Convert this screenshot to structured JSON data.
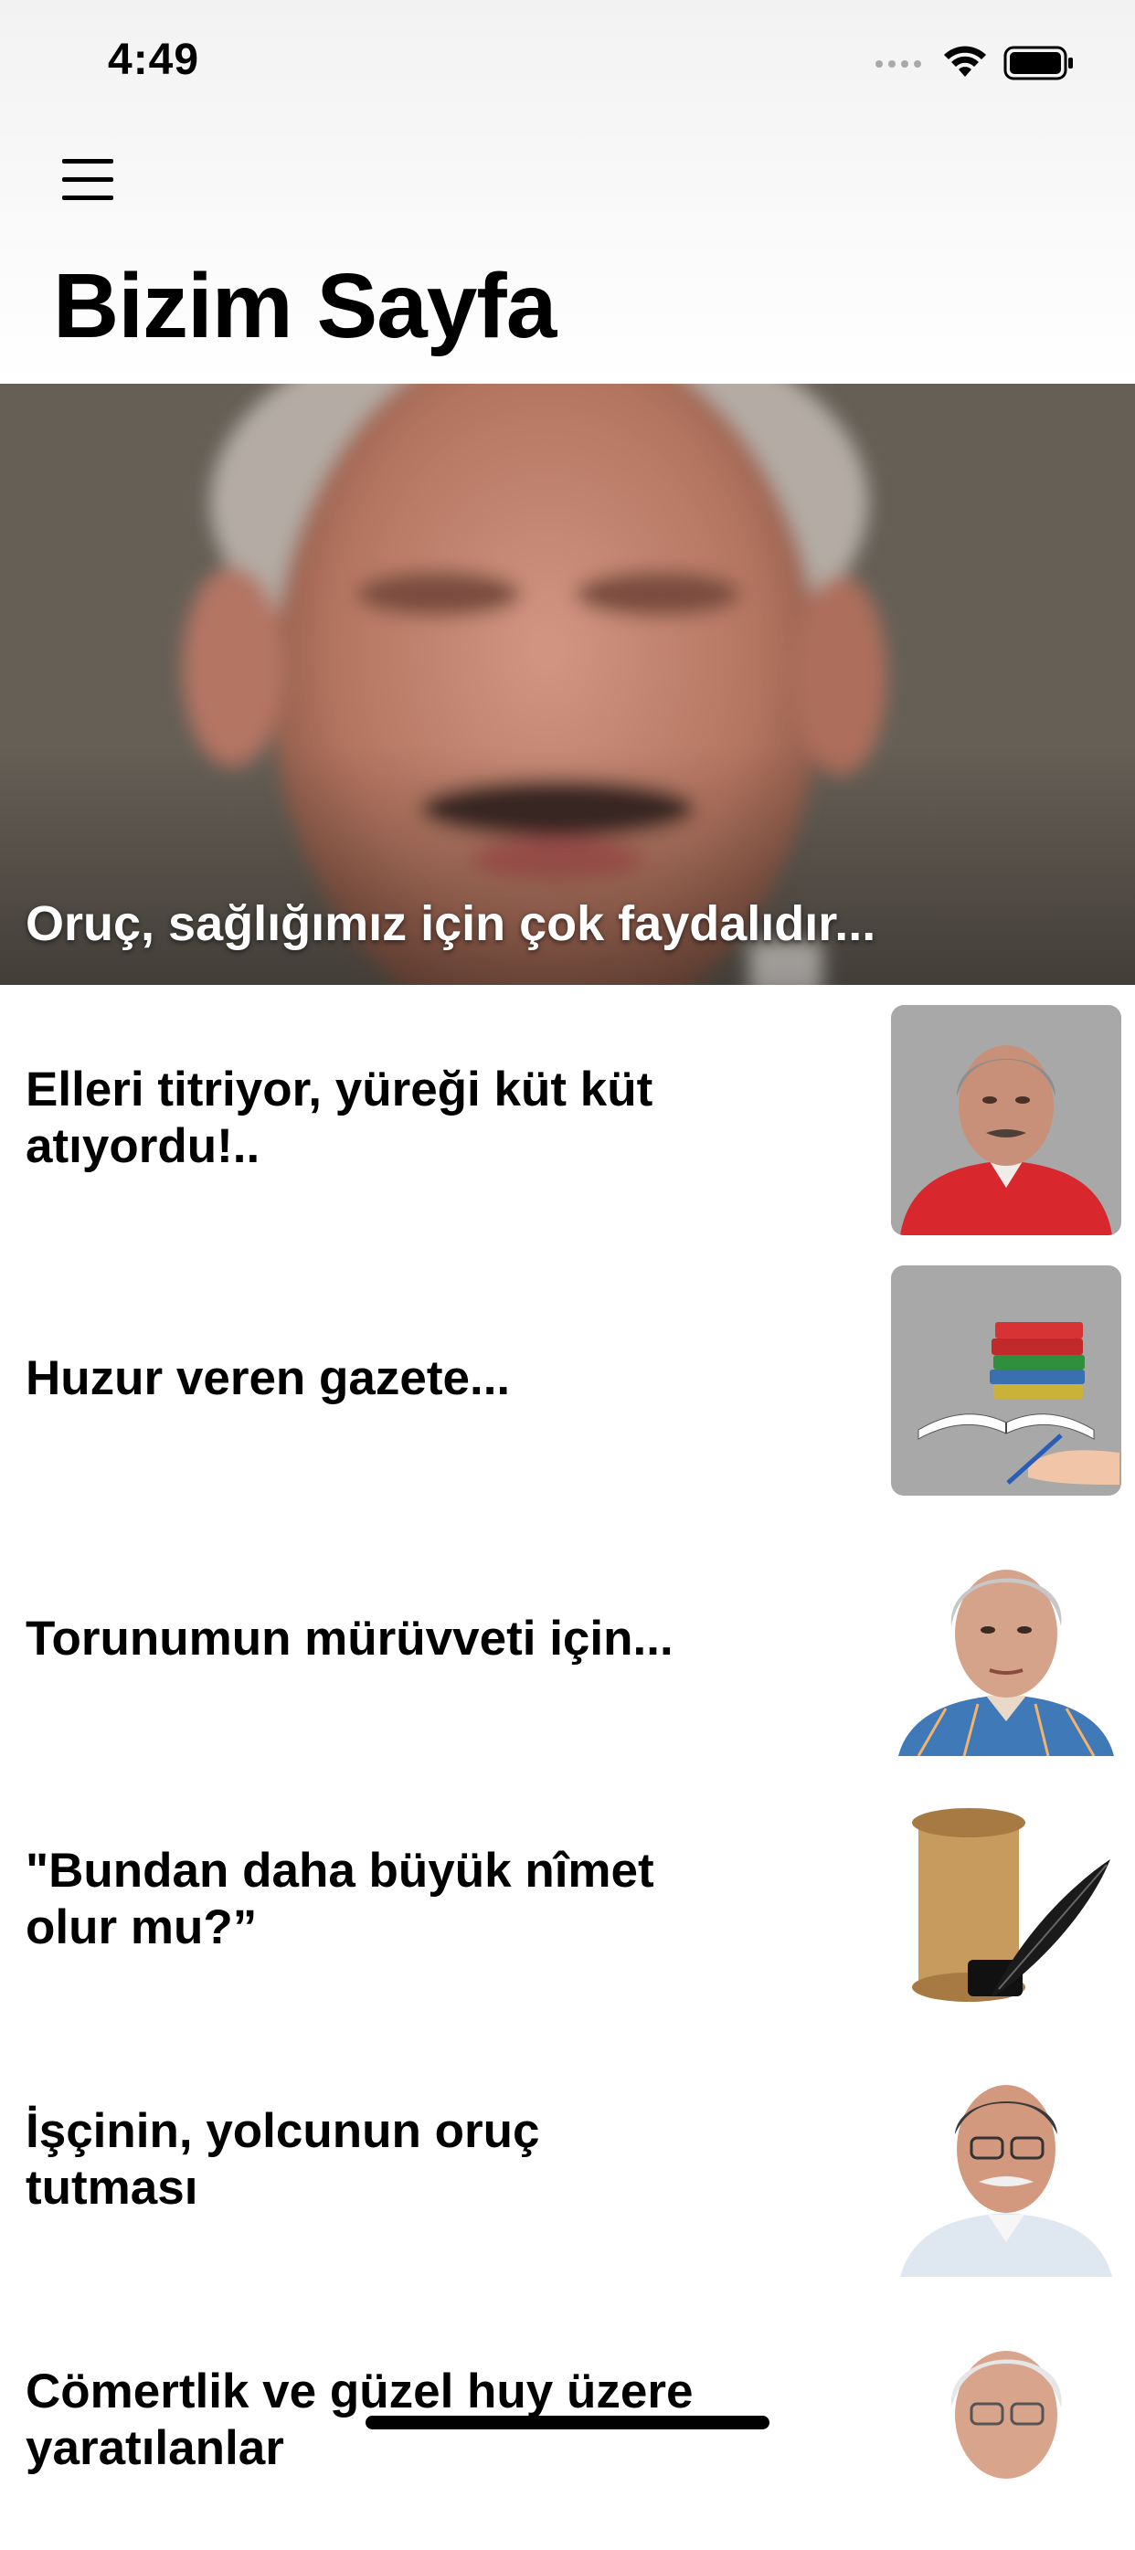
{
  "status_bar": {
    "time": "4:49"
  },
  "nav": {
    "title": "Bizim Sayfa"
  },
  "hero": {
    "caption": "Oruç, sağlığımız için çok faydalıdır..."
  },
  "articles": [
    {
      "title": "Elleri titriyor, yüreği küt küt atıyordu!..",
      "thumbnail": "author-portrait-red-shirt"
    },
    {
      "title": "Huzur veren gazete...",
      "thumbnail": "books-and-pen-illustration"
    },
    {
      "title": "Torunumun mürüvveti için...",
      "thumbnail": "author-portrait-plaid-shirt"
    },
    {
      "title": "\"Bundan daha büyük nîmet olur mu?”",
      "thumbnail": "scroll-and-quill-illustration"
    },
    {
      "title": "İşçinin, yolcunun oruç tutması",
      "thumbnail": "author-portrait-glasses"
    },
    {
      "title": "Cömertlik ve güzel huy üzere yaratılanlar",
      "thumbnail": "author-portrait-white-hair"
    }
  ],
  "colors": {
    "header_bg": "#f2f2f2",
    "hero_overlay_text": "#ffffff",
    "thumb_gray": "#a8a8a8",
    "shirt_red": "#d8282e"
  },
  "icons": [
    "hamburger-menu-icon",
    "wifi-icon",
    "battery-icon",
    "cellular-signal-icon"
  ]
}
